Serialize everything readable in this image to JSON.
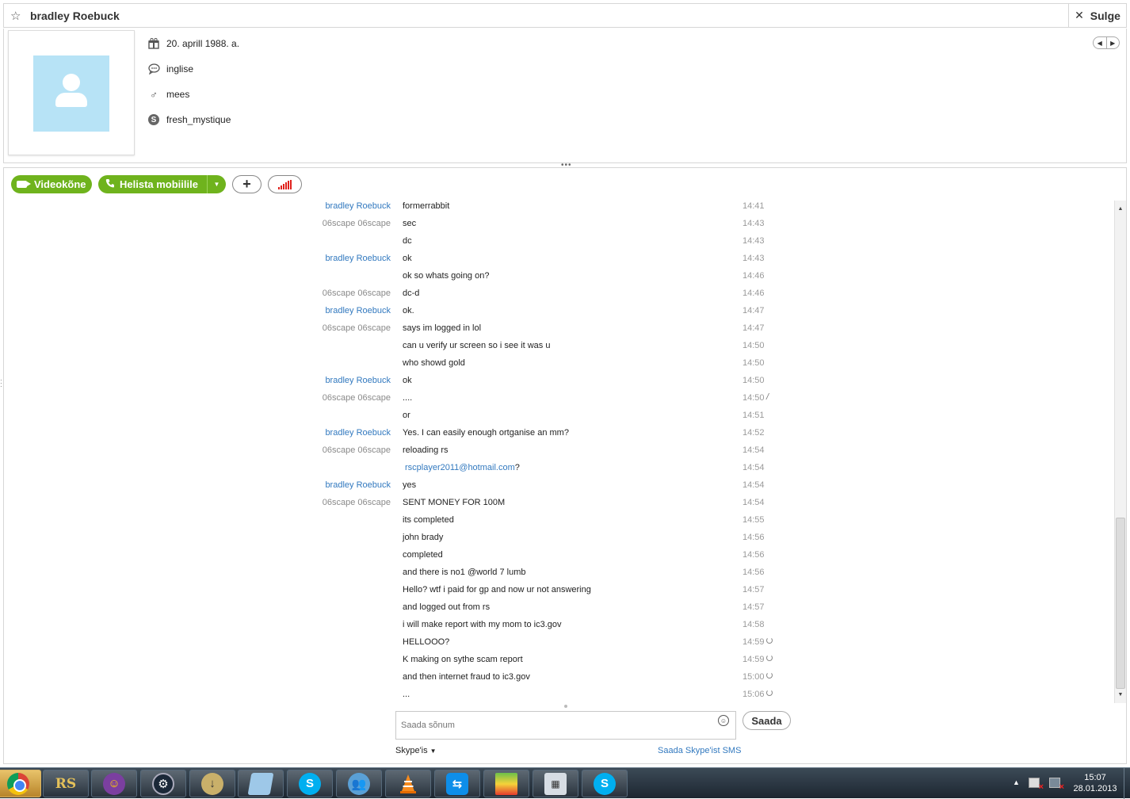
{
  "contact": {
    "name": "bradley Roebuck",
    "close_label": "Sulge",
    "birthday": "20. aprill 1988. a.",
    "language": "inglise",
    "gender": "mees",
    "skype_name": "fresh_mystique"
  },
  "toolbar": {
    "video_label": "Videokõne",
    "call_label": "Helista mobiilile"
  },
  "messages": [
    {
      "sender": "bradley Roebuck",
      "who": "brad",
      "text": "formerrabbit",
      "time": "14:41",
      "status": ""
    },
    {
      "sender": "06scape 06scape",
      "who": "other",
      "text": "sec",
      "time": "14:43",
      "status": ""
    },
    {
      "sender": "",
      "who": "other",
      "text": "dc",
      "time": "14:43",
      "status": ""
    },
    {
      "sender": "bradley Roebuck",
      "who": "brad",
      "text": "ok",
      "time": "14:43",
      "status": ""
    },
    {
      "sender": "",
      "who": "brad",
      "text": "ok so whats going on?",
      "time": "14:46",
      "status": ""
    },
    {
      "sender": "06scape 06scape",
      "who": "other",
      "text": "dc-d",
      "time": "14:46",
      "status": ""
    },
    {
      "sender": "bradley Roebuck",
      "who": "brad",
      "text": "ok.",
      "time": "14:47",
      "status": ""
    },
    {
      "sender": "06scape 06scape",
      "who": "other",
      "text": "says im logged in lol",
      "time": "14:47",
      "status": ""
    },
    {
      "sender": "",
      "who": "other",
      "text": "can u verify ur screen so i see it was u",
      "time": "14:50",
      "status": ""
    },
    {
      "sender": "",
      "who": "other",
      "text": "who showd gold",
      "time": "14:50",
      "status": ""
    },
    {
      "sender": "bradley Roebuck",
      "who": "brad",
      "text": "ok",
      "time": "14:50",
      "status": ""
    },
    {
      "sender": "06scape 06scape",
      "who": "other",
      "text": "....",
      "time": "14:50",
      "status": "edited"
    },
    {
      "sender": "",
      "who": "other",
      "text": "or",
      "time": "14:51",
      "status": ""
    },
    {
      "sender": "bradley Roebuck",
      "who": "brad",
      "text": "Yes. I can easily enough ortganise an mm?",
      "time": "14:52",
      "status": ""
    },
    {
      "sender": "06scape 06scape",
      "who": "other",
      "text": "reloading rs",
      "time": "14:54",
      "status": ""
    },
    {
      "sender": "",
      "who": "other",
      "text": "",
      "link": "rscplayer2011@hotmail.com",
      "suffix": "?",
      "time": "14:54",
      "status": ""
    },
    {
      "sender": "bradley Roebuck",
      "who": "brad",
      "text": "yes",
      "time": "14:54",
      "status": ""
    },
    {
      "sender": "06scape 06scape",
      "who": "other",
      "text": "SENT MONEY FOR 100M",
      "time": "14:54",
      "status": ""
    },
    {
      "sender": "",
      "who": "other",
      "text": "its completed",
      "time": "14:55",
      "status": ""
    },
    {
      "sender": "",
      "who": "other",
      "text": "john brady",
      "time": "14:56",
      "status": ""
    },
    {
      "sender": "",
      "who": "other",
      "text": "completed",
      "time": "14:56",
      "status": ""
    },
    {
      "sender": "",
      "who": "other",
      "text": "and there is no1 @world 7 lumb",
      "time": "14:56",
      "status": ""
    },
    {
      "sender": "",
      "who": "other",
      "text": "Hello? wtf i paid for gp and now ur not answering",
      "time": "14:57",
      "status": ""
    },
    {
      "sender": "",
      "who": "other",
      "text": "and logged out from rs",
      "time": "14:57",
      "status": ""
    },
    {
      "sender": "",
      "who": "other",
      "text": "i will make report with my mom to ic3.gov",
      "time": "14:58",
      "status": ""
    },
    {
      "sender": "",
      "who": "other",
      "text": "HELLOOO?",
      "time": "14:59",
      "status": "sending"
    },
    {
      "sender": "",
      "who": "other",
      "text": "K making on sythe scam report",
      "time": "14:59",
      "status": "sending"
    },
    {
      "sender": "",
      "who": "other",
      "text": "and then internet fraud to ic3.gov",
      "time": "15:00",
      "status": "sending"
    },
    {
      "sender": "",
      "who": "other",
      "text": "...",
      "time": "15:06",
      "status": "sending"
    }
  ],
  "composer": {
    "placeholder": "Saada sõnum",
    "send_label": "Saada",
    "via_label": "Skype'is",
    "sms_label": "Saada Skype'ist SMS"
  },
  "taskbar": {
    "apps": [
      "chrome",
      "runescape",
      "yahoo-messenger",
      "steam",
      "download-manager",
      "notepad",
      "skype",
      "contacts",
      "vlc",
      "teamviewer",
      "bluestacks",
      "calculator",
      "skype"
    ],
    "active_app": "chrome",
    "clock_time": "15:07",
    "clock_date": "28.01.2013"
  },
  "colors": {
    "accent_green": "#6fb31d",
    "link_blue": "#3279bf",
    "signal_red": "#e0201b"
  }
}
